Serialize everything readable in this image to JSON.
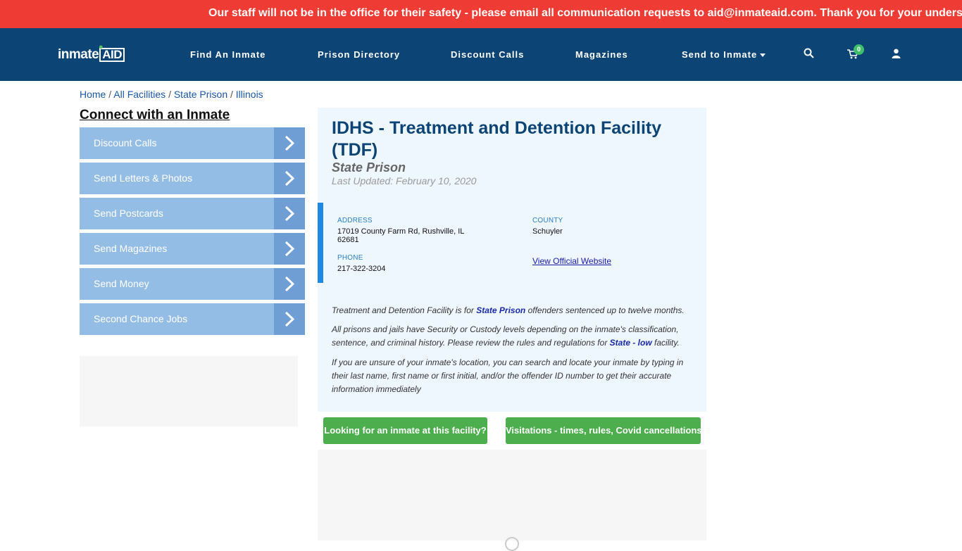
{
  "alert": {
    "text": "Our staff will not be in the office for their safety - please email all communication requests to aid@inmateaid.com. Thank you for your understanding."
  },
  "nav": {
    "logo_part1": "inmate",
    "logo_part2": "AID",
    "links": [
      "Find An Inmate",
      "Prison Directory",
      "Discount Calls",
      "Magazines",
      "Send to Inmate"
    ],
    "cart_count": "0",
    "icons": [
      "search-icon",
      "cart-icon",
      "user-icon"
    ]
  },
  "breadcrumb": {
    "items": [
      "Home",
      "All Facilities",
      "State Prison",
      "Illinois"
    ],
    "separator": "/"
  },
  "sidebar": {
    "title": "Connect with an Inmate",
    "items": [
      "Discount Calls",
      "Send Letters & Photos",
      "Send Postcards",
      "Send Magazines",
      "Send Money",
      "Second Chance Jobs"
    ]
  },
  "facility": {
    "title": "IDHS - Treatment and Detention Facility (TDF)",
    "type": "State Prison",
    "updated": "Last Updated: February 10, 2020",
    "address_label": "ADDRESS",
    "address": "17019 County Farm Rd, Rushville, IL 62681",
    "county_label": "COUNTY",
    "county": "Schuyler",
    "phone_label": "PHONE",
    "phone": "217-322-3204",
    "website_label": "View Official Website",
    "para1_pre": "Treatment and Detention Facility is for",
    "para1_link": "State Prison",
    "para1_post": "offenders sentenced up to twelve months.",
    "para2_pre": "All prisons and jails have Security or Custody levels depending on the inmate's classification, sentence, and criminal history. Please review the rules and regulations for",
    "para2_link": "State - low",
    "para2_post": "facility.",
    "para3": "If you are unsure of your inmate's location, you can search and locate your inmate by typing in their last name, first name or first initial, and/or the offender ID number to get their accurate information immediately"
  },
  "buttons": {
    "find": "Looking for an inmate at this facility?",
    "visit": "Visitations - times, rules, Covid cancellations"
  },
  "colors": {
    "alert": "#ee3b33",
    "nav": "#0b4475",
    "sidebar_button": "#94bde5",
    "sidebar_arrow": "#6f9ed4",
    "action_button": "#4cae4c",
    "card": "#eef7fd"
  }
}
